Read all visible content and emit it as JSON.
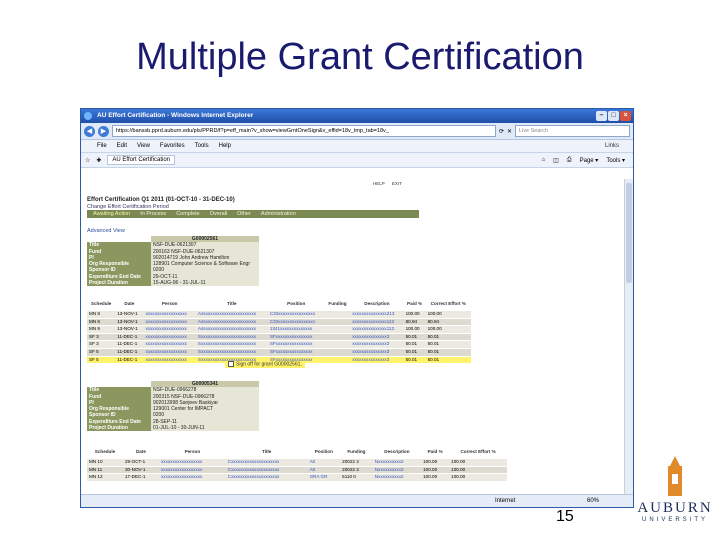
{
  "slide": {
    "title": "Multiple Grant Certification",
    "number": "15",
    "logo_word": "AUBURN",
    "logo_sub": "UNIVERSITY",
    "logo_icon": "tower-icon"
  },
  "browser": {
    "window_title": "AU Effort Certification - Windows Internet Explorer",
    "address": "https://banssb.pprd.auburn.edu/pls/PPRD/f?p=eff_main?v_show=viewGrntOneSign&v_effid=18v_tmp_tab=18v_",
    "search_placeholder": "Live Search",
    "menu": [
      "File",
      "Edit",
      "View",
      "Favorites",
      "Tools",
      "Help"
    ],
    "links_label": "Links",
    "tab_label": "AU Effort Certification",
    "toolbar_right": [
      "Page ▾",
      "Tools ▾"
    ],
    "status_zone": "Internet",
    "status_zoom": "60%",
    "accent_color": "#2d5aa7"
  },
  "page": {
    "header_links": "HELP EXIT",
    "title": "Effort Certification  Q1 2011 (01-OCT-10 - 31-DEC-10)",
    "subtitle": "Change Effort Certification Period",
    "tabs": [
      "Awaiting Action",
      "In Process",
      "Complete",
      "Overall",
      "Other",
      "Administration"
    ],
    "advanced_view": "Advanced View",
    "grant1": {
      "id": "G00002561",
      "fields": [
        {
          "label": "Title",
          "value": "NSF-DUE-0621307"
        },
        {
          "label": "Fund",
          "value": "200163 NSF-DUE-0621307"
        },
        {
          "label": "PI",
          "value": "902014719 John Andrew Hamilton"
        },
        {
          "label": "Org Responsible",
          "value": "128901 Computer Science & Software Engr"
        },
        {
          "label": "Sponsor ID",
          "value": "0200"
        },
        {
          "label": "Expenditure End Date",
          "value": "29-OCT-11"
        },
        {
          "label": "Project Duration",
          "value": "15-AUG-06 - 31-JUL-11"
        }
      ],
      "columns": [
        "Schedule",
        "Date",
        "Person",
        "Title",
        "Position",
        "Funding",
        "Description",
        "Paid %",
        "Correct Effort %"
      ],
      "rows": [
        {
          "schedule": "MN 8",
          "date": "13-NOV-1",
          "person": "xxxxxxxxxxxxxxxxxx",
          "title": "Assxxxxxxxxxxxxxxxxxxxxxx",
          "pos": "C33xxxxxxxxxxxxxxxx",
          "fund": "",
          "desc": "xxxxxxxxxxxxxxx213",
          "paid": "100.00",
          "effort": "100.00"
        },
        {
          "schedule": "MN 8",
          "date": "13-NOV-1",
          "person": "xxxxxxxxxxxxxxxxxx",
          "title": "Assxxxxxxxxxxxxxxxxxxxxxx",
          "pos": "C33xxxxxxxxxxxxxxxx",
          "fund": "",
          "desc": "xxxxxxxxxxxxxxx113",
          "paid": "80.94",
          "effort": "80.94"
        },
        {
          "schedule": "MN 9",
          "date": "13-NOV-1",
          "person": "xxxxxxxxxxxxxxxxxx",
          "title": "Assxxxxxxxxxxxxxxxxxxxxxx",
          "pos": "1341xxxxxxxxxxxxxx",
          "fund": "",
          "desc": "xxxxxxxxxxxxxxx113",
          "paid": "100.00",
          "effort": "100.00"
        },
        {
          "schedule": "SF 3",
          "date": "11-DEC-1",
          "person": "xxxxxxxxxxxxxxxxxx",
          "title": "Sxxxxxxxxxxxxxxxxxxxxxxxx",
          "pos": "SFxxxxxxxxxxxxxxxx",
          "fund": "",
          "desc": "xxxxxxxxxxxxxxx3",
          "paid": "50.01",
          "effort": "50.01"
        },
        {
          "schedule": "SF 3",
          "date": "11-DEC-1",
          "person": "xxxxxxxxxxxxxxxxxx",
          "title": "Sxxxxxxxxxxxxxxxxxxxxxxxx",
          "pos": "SFxxxxxxxxxxxxxxxx",
          "fund": "",
          "desc": "xxxxxxxxxxxxxxx3",
          "paid": "50.01",
          "effort": "50.01"
        },
        {
          "schedule": "SF 5",
          "date": "11-DEC-1",
          "person": "xxxxxxxxxxxxxxxxxx",
          "title": "Sxxxxxxxxxxxxxxxxxxxxxxxx",
          "pos": "SFxxxxxxxxxxxxxxxx",
          "fund": "",
          "desc": "xxxxxxxxxxxxxxx3",
          "paid": "50.01",
          "effort": "50.01"
        },
        {
          "schedule": "SF 5",
          "date": "11-DEC-1",
          "person": "xxxxxxxxxxxxxxxxxx",
          "title": "Sxxxxxxxxxxxxxxxxxxxxxxxx",
          "pos": "SFxxxxxxxxxxxxxxxx",
          "fund": "",
          "desc": "xxxxxxxxxxxxxxx3",
          "paid": "50.01",
          "effort": "50.01"
        }
      ],
      "signoff": "Sign off for grant G00002561."
    },
    "grant2": {
      "id": "G00005341",
      "fields": [
        {
          "label": "Title",
          "value": "NSF-DUE-0966278"
        },
        {
          "label": "Fund",
          "value": "200315 NSF-DUE-0966278"
        },
        {
          "label": "PI",
          "value": "902013998 Sanjeev Baskiyar"
        },
        {
          "label": "Org Responsible",
          "value": "129001 Center for IMPACT"
        },
        {
          "label": "Sponsor ID",
          "value": "0200"
        },
        {
          "label": "Expenditure End Date",
          "value": "28-SEP-11"
        },
        {
          "label": "Project Duration",
          "value": "01-JUL-10 - 30-JUN-11"
        }
      ],
      "columns": [
        "Schedule",
        "Date",
        "Person",
        "Title",
        "Position",
        "Funding",
        "Description",
        "Paid %",
        "Correct Effort %"
      ],
      "rows": [
        {
          "schedule": "MN 10",
          "date": "29-OCT-1",
          "person": "xxxxxxxxxxxxxxxxxx",
          "title": "Cxxxxxxxxxxxxxxxxxxxxx",
          "pos": "A0",
          "fund": "20022 3",
          "desc": "Nxxxxxxxxxx2",
          "paid": "100.00",
          "effort": "100.00"
        },
        {
          "schedule": "MN 11",
          "date": "30-NOV-1",
          "person": "xxxxxxxxxxxxxxxxxx",
          "title": "Cxxxxxxxxxxxxxxxxxxxxx",
          "pos": "A0",
          "fund": "20022 3",
          "desc": "Nxxxxxxxxxx2",
          "paid": "100.00",
          "effort": "100.00"
        },
        {
          "schedule": "MN 12",
          "date": "17-DEC-1",
          "person": "xxxxxxxxxxxxxxxxxx",
          "title": "Cxxxxxxxxxxxxxxxxxxxxx",
          "pos": "GRA GR",
          "fund": "5110 0",
          "desc": "Nxxxxxxxxxx2",
          "paid": "100.00",
          "effort": "100.00"
        }
      ]
    }
  }
}
